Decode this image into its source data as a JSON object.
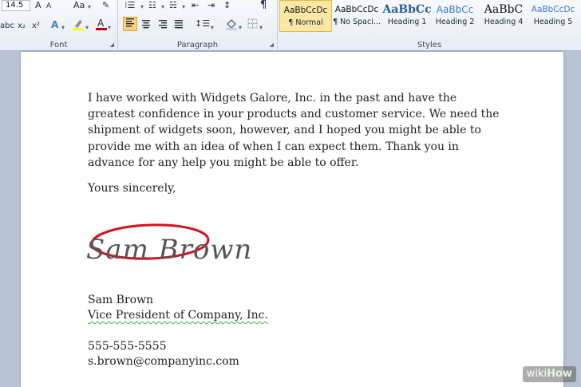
{
  "ribbon": {
    "font_group": {
      "label": "Font",
      "size": "14.5",
      "grow": "A",
      "shrink": "A",
      "change_case": "Aa"
    },
    "paragraph_group": {
      "label": "Paragraph",
      "show_marks": "¶"
    },
    "styles_group": {
      "label": "Styles",
      "items": [
        {
          "preview": "AaBbCcDc",
          "name": "¶ Normal"
        },
        {
          "preview": "AaBbCcDc",
          "name": "¶ No Spaci..."
        },
        {
          "preview": "AaBbCc",
          "name": "Heading 1"
        },
        {
          "preview": "AaBbCc",
          "name": "Heading 2"
        },
        {
          "preview": "AaBbC",
          "name": "Heading 4"
        },
        {
          "preview": "AaBbCcDc",
          "name": "Heading 5"
        }
      ]
    },
    "colors": {
      "selected_style": "#fbe8a6",
      "heading_blue": "#2f5d9a",
      "highlight": "#ffff00",
      "font_color_bar": "#c00000"
    }
  },
  "document": {
    "body_paragraph": "I have worked with Widgets Galore, Inc. in the past and have the greatest confidence in your products and customer service. We need the shipment of widgets soon, however, and I hoped you might be able to provide me with an idea of when I can expect them. Thank you in advance for any help you might be able to offer.",
    "closing": "Yours sincerely,",
    "signature": "Sam Brown",
    "name": "Sam Brown",
    "title": "Vice President of Company, Inc.",
    "phone": "555-555-5555",
    "email": "s.brown@companyinc.com",
    "annotation_color": "#d0141c"
  },
  "watermark": {
    "wiki": "wiki",
    "how": "How"
  }
}
